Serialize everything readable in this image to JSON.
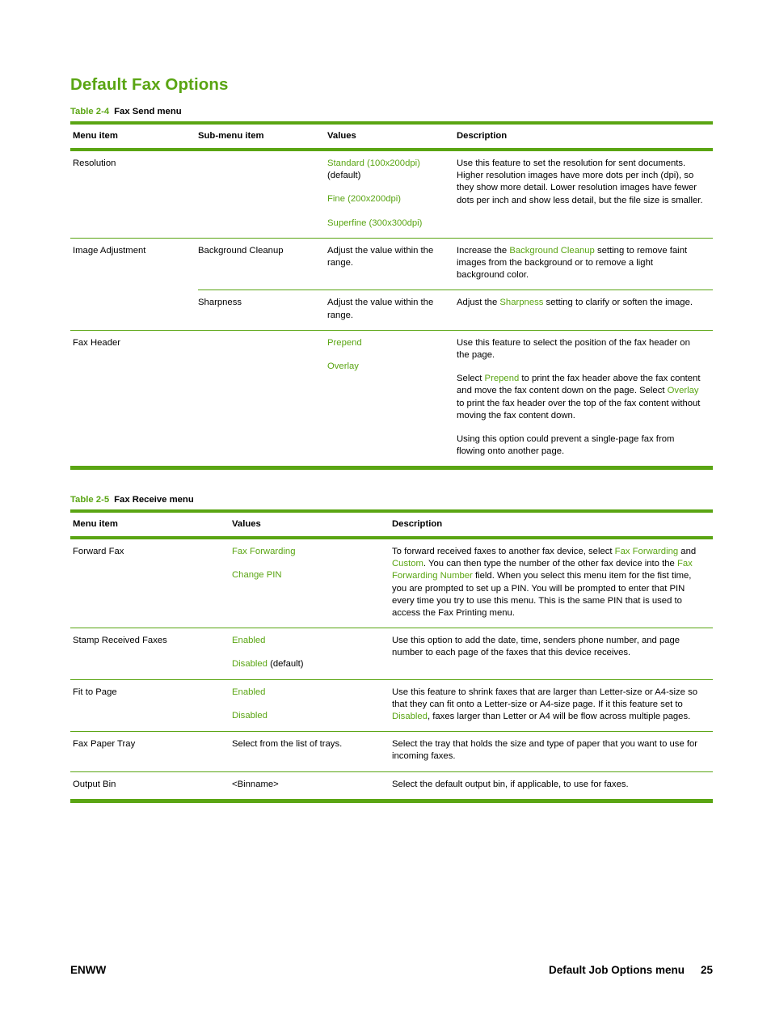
{
  "page": {
    "title": "Default Fax Options"
  },
  "footer": {
    "left": "ENWW",
    "section": "Default Job Options menu",
    "page_number": "25"
  },
  "colors": {
    "accent_green": "#5aa513",
    "text_black": "#000000",
    "rule_green": "#5aa513"
  },
  "table_fax_send": {
    "caption_number": "Table 2-4",
    "caption_title": "Fax Send menu",
    "headers": [
      "Menu item",
      "Sub-menu item",
      "Values",
      "Description"
    ],
    "rows": [
      {
        "menu_item": "Resolution",
        "sub_menu_item": "",
        "values_1_term": "Standard (100x200dpi)",
        "values_1_note": "(default)",
        "values_2_term": "Fine (200x200dpi)",
        "values_3_term": "Superfine (300x300dpi)",
        "description": "Use this feature to set the resolution for sent documents. Higher resolution images have more dots per inch (dpi), so they show more detail. Lower resolution images have fewer dots per inch and show less detail, but the file size is smaller."
      },
      {
        "menu_item": "Image Adjustment",
        "sub_menu_item": "Background Cleanup",
        "values": "Adjust the value within the range.",
        "desc_a": "Increase the ",
        "desc_term": "Background Cleanup",
        "desc_b": " setting to remove faint images from the background or to remove a light background color."
      },
      {
        "menu_item": "",
        "sub_menu_item": "Sharpness",
        "values": "Adjust the value within the range.",
        "desc_a": "Adjust the ",
        "desc_term": "Sharpness",
        "desc_b": " setting to clarify or soften the image."
      },
      {
        "menu_item": "Fax Header",
        "values_1_term": "Prepend",
        "values_2_term": "Overlay",
        "desc_p1": "Use this feature to select the position of the fax header on the page.",
        "desc_p2_a": "Select ",
        "desc_p2_term1": "Prepend",
        "desc_p2_b": " to print the fax header above the fax content and move the fax content down on the page. Select ",
        "desc_p2_term2": "Overlay",
        "desc_p2_c": " to print the fax header over the top of the fax content without moving the fax content down.",
        "desc_p3": "Using this option could prevent a single-page fax from flowing onto another page."
      }
    ]
  },
  "table_fax_receive": {
    "caption_number": "Table 2-5",
    "caption_title": "Fax Receive menu",
    "headers": [
      "Menu item",
      "Values",
      "Description"
    ],
    "rows": [
      {
        "menu_item": "Forward Fax",
        "values_1": "Fax Forwarding",
        "values_2": "Change PIN",
        "desc_a": "To forward received faxes to another fax device, select ",
        "desc_term1": "Fax Forwarding",
        "desc_b": " and ",
        "desc_term2": "Custom",
        "desc_c": ". You can then type the number of the other fax device into the ",
        "desc_term3": "Fax Forwarding Number",
        "desc_d": " field. When you select this menu item for the fist time, you are prompted to set up a PIN. You will be prompted to enter that PIN every time you try to use this menu. This is the same PIN that is used to access the Fax Printing menu."
      },
      {
        "menu_item": "Stamp Received Faxes",
        "values_1": "Enabled",
        "values_2": "Disabled",
        "values_2_note": "(default)",
        "description": "Use this option to add the date, time, senders phone number, and page number to each page of the faxes that this device receives."
      },
      {
        "menu_item": "Fit to Page",
        "values_1": "Enabled",
        "values_2": "Disabled",
        "desc_a": "Use this feature to shrink faxes that are larger than Letter-size or A4-size so that they can fit onto a Letter-size or A4-size page. If it this feature set to ",
        "desc_term": "Disabled",
        "desc_b": ", faxes larger than Letter or A4 will be flow across multiple pages."
      },
      {
        "menu_item": "Fax Paper Tray",
        "values_plain": "Select from the list of trays.",
        "description": "Select the tray that holds the size and type of paper that you want to use for incoming faxes."
      },
      {
        "menu_item": "Output Bin",
        "values_plain": "<Binname>",
        "description": "Select the default output bin, if applicable, to use for faxes."
      }
    ]
  }
}
